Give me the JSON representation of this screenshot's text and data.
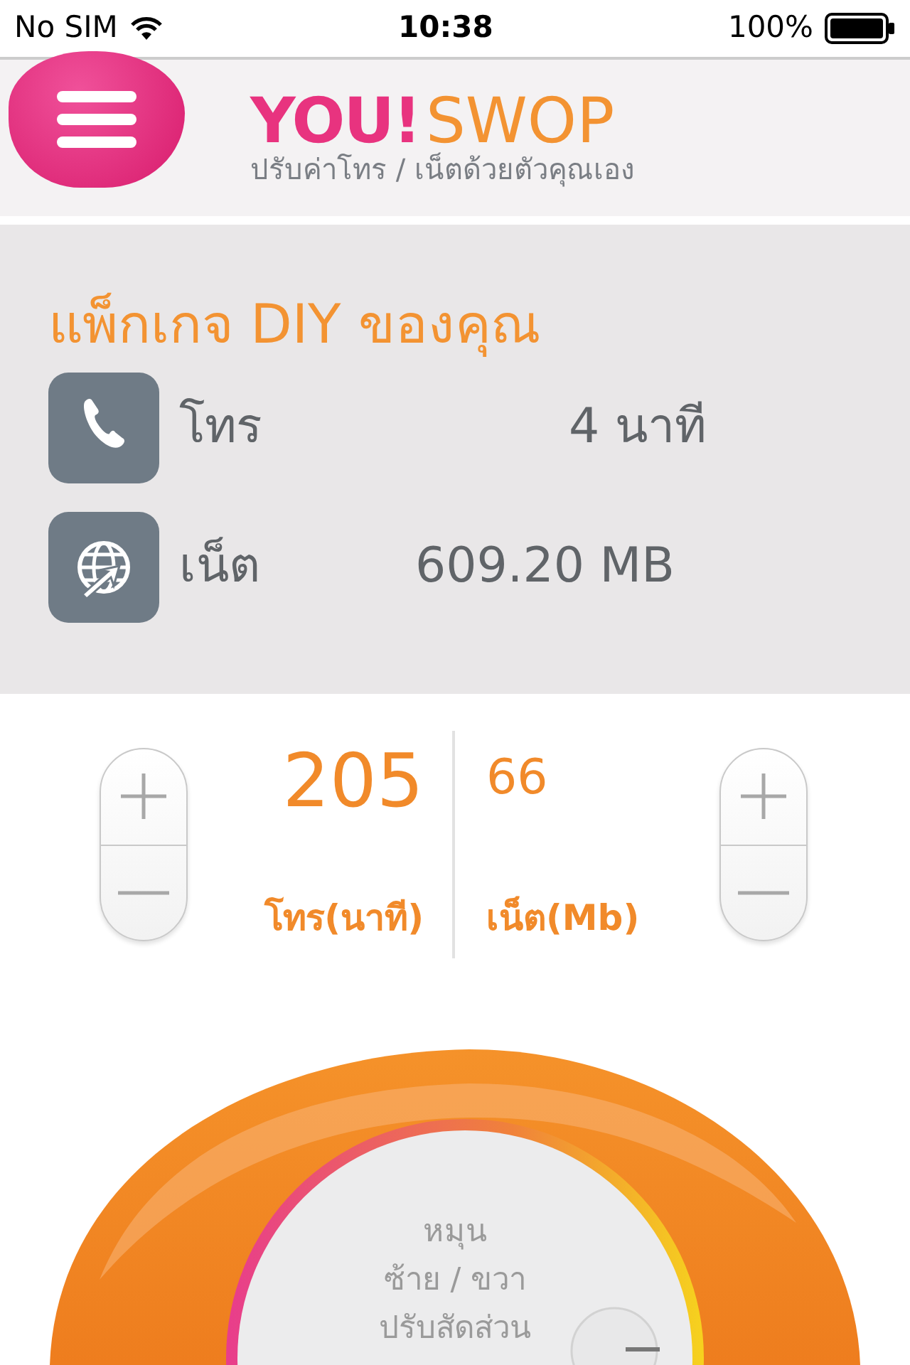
{
  "status_bar": {
    "carrier": "No SIM",
    "time": "10:38",
    "battery": "100%"
  },
  "header": {
    "logo_you": "YOU!",
    "logo_swop": "SWOP",
    "tagline": "ปรับค่าโทร / เน็ตด้วยตัวคุณเอง"
  },
  "package": {
    "title": "แพ็กเกจ DIY ของคุณ",
    "rows": [
      {
        "kind": "call",
        "label": "โทร",
        "value": "4 นาที"
      },
      {
        "kind": "net",
        "label": "เน็ต",
        "value": "609.20 MB"
      }
    ]
  },
  "adjusters": [
    {
      "value": "205",
      "label": "โทร(นาที)",
      "selected": true
    },
    {
      "value": "66",
      "label": "เน็ต(Mb)",
      "selected": false
    }
  ],
  "dial": {
    "lines": [
      "หมุน",
      "ซ้าย / ขวา",
      "ปรับสัดส่วน"
    ]
  }
}
